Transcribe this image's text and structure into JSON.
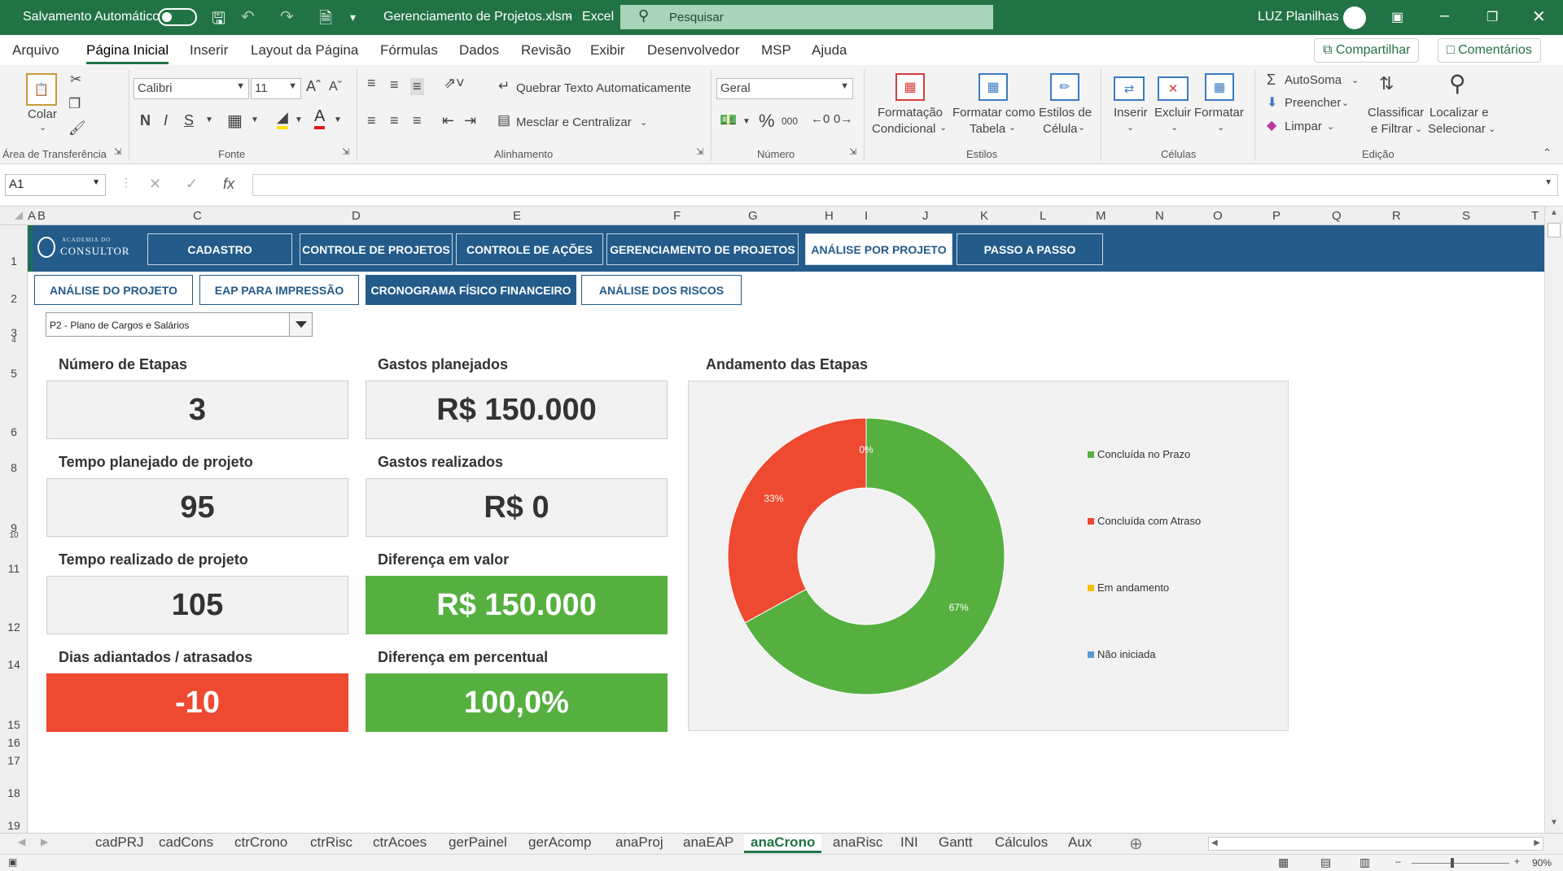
{
  "titlebar": {
    "autosave_label": "Salvamento Automático",
    "filename": "Gerenciamento de Projetos.xlsm",
    "sep": "-",
    "app": "Excel",
    "search_placeholder": "Pesquisar",
    "user": "LUZ Planilhas"
  },
  "menu": {
    "tabs": [
      "Arquivo",
      "Página Inicial",
      "Inserir",
      "Layout da Página",
      "Fórmulas",
      "Dados",
      "Revisão",
      "Exibir",
      "Desenvolvedor",
      "MSP",
      "Ajuda"
    ],
    "share": "Compartilhar",
    "comments": "Comentários"
  },
  "ribbon": {
    "clipboard": {
      "paste": "Colar",
      "label": "Área de Transferência"
    },
    "font": {
      "name": "Calibri",
      "size": "11",
      "label": "Fonte",
      "bold": "N",
      "italic": "I",
      "underline": "S"
    },
    "alignment": {
      "wrap": "Quebrar Texto Automaticamente",
      "merge": "Mesclar e Centralizar",
      "label": "Alinhamento"
    },
    "number": {
      "format": "Geral",
      "label": "Número",
      "percent": "%",
      "thousands": "000"
    },
    "styles": {
      "conditional1": "Formatação",
      "conditional2": "Condicional",
      "table1": "Formatar como",
      "table2": "Tabela",
      "cell1": "Estilos de",
      "cell2": "Célula",
      "label": "Estilos"
    },
    "cells": {
      "insert": "Inserir",
      "delete": "Excluir",
      "format": "Formatar",
      "label": "Células"
    },
    "editing": {
      "autosum": "AutoSoma",
      "fill": "Preencher",
      "clear": "Limpar",
      "sort1": "Classificar",
      "sort2": "e Filtrar",
      "find1": "Localizar e",
      "find2": "Selecionar",
      "label": "Edição"
    }
  },
  "formula_bar": {
    "name_box": "A1",
    "fx": "fx",
    "content": ""
  },
  "columns": [
    "A",
    "B",
    "C",
    "D",
    "E",
    "F",
    "G",
    "H",
    "I",
    "J",
    "K",
    "L",
    "M",
    "N",
    "O",
    "P",
    "Q",
    "R",
    "S",
    "T"
  ],
  "rows": [
    "1",
    "2",
    "3",
    "4",
    "5",
    "6",
    "8",
    "9",
    "10",
    "11",
    "12",
    "14",
    "15",
    "16",
    "17",
    "18",
    "19"
  ],
  "logo": {
    "line1": "ACADEMIA DO",
    "line2": "CONSULTOR"
  },
  "nav": [
    "CADASTRO",
    "CONTROLE DE PROJETOS",
    "CONTROLE DE AÇÕES",
    "GERENCIAMENTO DE  PROJETOS",
    "ANÁLISE POR PROJETO",
    "PASSO A PASSO"
  ],
  "subnav": [
    "ANÁLISE DO PROJETO",
    "EAP PARA IMPRESSÃO",
    "CRONOGRAMA FÍSICO FINANCEIRO",
    "ANÁLISE DOS RISCOS"
  ],
  "project_select": "P2 - Plano de Cargos e Salários",
  "kpis": {
    "etapas_label": "Número de Etapas",
    "etapas": "3",
    "gastos_plan_label": "Gastos planejados",
    "gastos_plan": "R$ 150.000",
    "tempo_plan_label": "Tempo planejado de projeto",
    "tempo_plan": "95",
    "gastos_real_label": "Gastos realizados",
    "gastos_real": "R$ 0",
    "tempo_real_label": "Tempo realizado de projeto",
    "tempo_real": "105",
    "dif_valor_label": "Diferença em valor",
    "dif_valor": "R$ 150.000",
    "dias_label": "Dias adiantados / atrasados",
    "dias": "-10",
    "dif_perc_label": "Diferença em percentual",
    "dif_perc": "100,0%"
  },
  "chart_data": {
    "type": "pie",
    "title": "Andamento das Etapas",
    "categories": [
      "Concluída no Prazo",
      "Concluída com Atraso",
      "Em andamento",
      "Não iniciada"
    ],
    "values": [
      67,
      33,
      0,
      0
    ],
    "data_labels": [
      "67%",
      "33%",
      "0%",
      ""
    ],
    "colors": [
      "#56b040",
      "#ee4931",
      "#f6c000",
      "#5b9bd5"
    ],
    "donut": true,
    "legend": "right"
  },
  "sheet_tabs": [
    "cadPRJ",
    "cadCons",
    "ctrCrono",
    "ctrRisc",
    "ctrAcoes",
    "gerPainel",
    "gerAcomp",
    "anaProj",
    "anaEAP",
    "anaCrono",
    "anaRisc",
    "INI",
    "Gantt",
    "Cálculos",
    "Aux"
  ],
  "active_tab": "anaCrono",
  "status": {
    "zoom": "90%"
  }
}
